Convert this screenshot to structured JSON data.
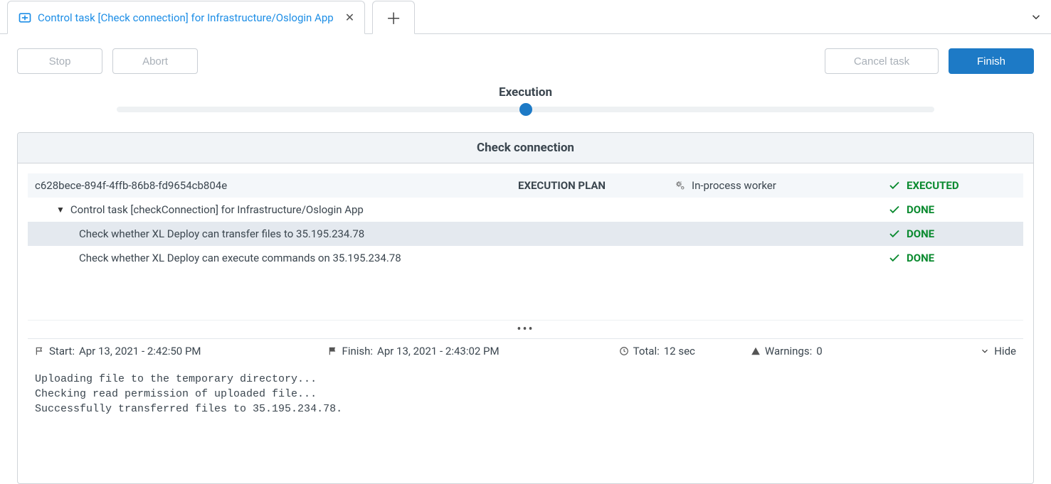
{
  "tab": {
    "title": "Control task [Check connection] for Infrastructure/Oslogin App"
  },
  "actions": {
    "stop": "Stop",
    "abort": "Abort",
    "cancel": "Cancel task",
    "finish": "Finish"
  },
  "progress": {
    "label": "Execution"
  },
  "panel": {
    "title": "Check connection"
  },
  "plan": {
    "guid": "c628bece-894f-4ffb-86b8-fd9654cb804e",
    "plan_label": "EXECUTION PLAN",
    "worker": "In-process worker",
    "status_executed": "EXECUTED",
    "status_done": "DONE",
    "task_label": "Control task [checkConnection] for Infrastructure/Oslogin App",
    "step1": "Check whether XL Deploy can transfer files to 35.195.234.78",
    "step2": "Check whether XL Deploy can execute commands on 35.195.234.78"
  },
  "details": {
    "start_label": "Start:",
    "start_value": "Apr 13, 2021 - 2:42:50 PM",
    "finish_label": "Finish:",
    "finish_value": "Apr 13, 2021 - 2:43:02 PM",
    "total_label": "Total:",
    "total_value": "12 sec",
    "warnings_label": "Warnings:",
    "warnings_value": "0",
    "hide": "Hide"
  },
  "log": "Uploading file to the temporary directory...\nChecking read permission of uploaded file...\nSuccessfully transferred files to 35.195.234.78."
}
